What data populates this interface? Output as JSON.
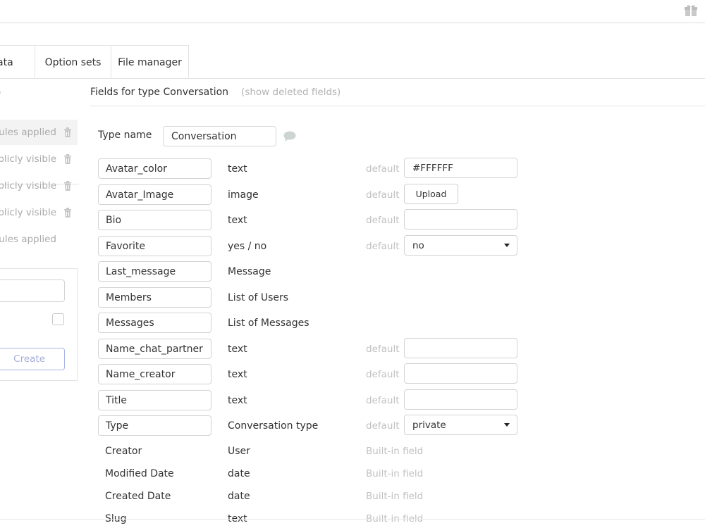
{
  "tabs": [
    {
      "label": "ata"
    },
    {
      "label": "Option sets"
    },
    {
      "label": "File manager"
    }
  ],
  "left_panel": {
    "partial_header": ")",
    "rows": [
      {
        "text": "rules applied",
        "has_trash": true
      },
      {
        "text": "ublicly visible",
        "has_trash": true
      },
      {
        "text": "ublicly visible",
        "has_trash": true
      },
      {
        "text": "ublicly visible",
        "has_trash": true
      },
      {
        "text": "rules applied",
        "has_trash": false
      }
    ],
    "create_button": "Create"
  },
  "fields_header": {
    "title": "Fields for type Conversation",
    "show_deleted": "(show deleted fields)"
  },
  "type_name": {
    "label": "Type name",
    "value": "Conversation"
  },
  "fields": [
    {
      "name": "Avatar_color",
      "type": "text",
      "default_label": "default",
      "default_value": "#FFFFFF",
      "control": "input"
    },
    {
      "name": "Avatar_Image",
      "type": "image",
      "default_label": "default",
      "default_value": "Upload",
      "control": "button"
    },
    {
      "name": "Bio",
      "type": "text",
      "default_label": "default",
      "default_value": "",
      "control": "input"
    },
    {
      "name": "Favorite",
      "type": "yes / no",
      "default_label": "default",
      "default_value": "no",
      "control": "select"
    },
    {
      "name": "Last_message",
      "type": "Message",
      "default_label": "",
      "default_value": "",
      "control": "none"
    },
    {
      "name": "Members",
      "type": "List of Users",
      "default_label": "",
      "default_value": "",
      "control": "none"
    },
    {
      "name": "Messages",
      "type": "List of Messages",
      "default_label": "",
      "default_value": "",
      "control": "none"
    },
    {
      "name": "Name_chat_partner",
      "type": "text",
      "default_label": "default",
      "default_value": "",
      "control": "input"
    },
    {
      "name": "Name_creator",
      "type": "text",
      "default_label": "default",
      "default_value": "",
      "control": "input"
    },
    {
      "name": "Title",
      "type": "text",
      "default_label": "default",
      "default_value": "",
      "control": "input"
    },
    {
      "name": "Type",
      "type": "Conversation type",
      "default_label": "default",
      "default_value": "private",
      "control": "select"
    }
  ],
  "builtin_fields": [
    {
      "name": "Creator",
      "type": "User",
      "note": "Built-in field"
    },
    {
      "name": "Modified Date",
      "type": "date",
      "note": "Built-in field"
    },
    {
      "name": "Created Date",
      "type": "date",
      "note": "Built-in field"
    },
    {
      "name": "Slug",
      "type": "text",
      "note": "Built-in field"
    }
  ],
  "icons": {
    "top_right": "gift-icon",
    "trash": "trash-icon",
    "comment": "comment-icon"
  }
}
